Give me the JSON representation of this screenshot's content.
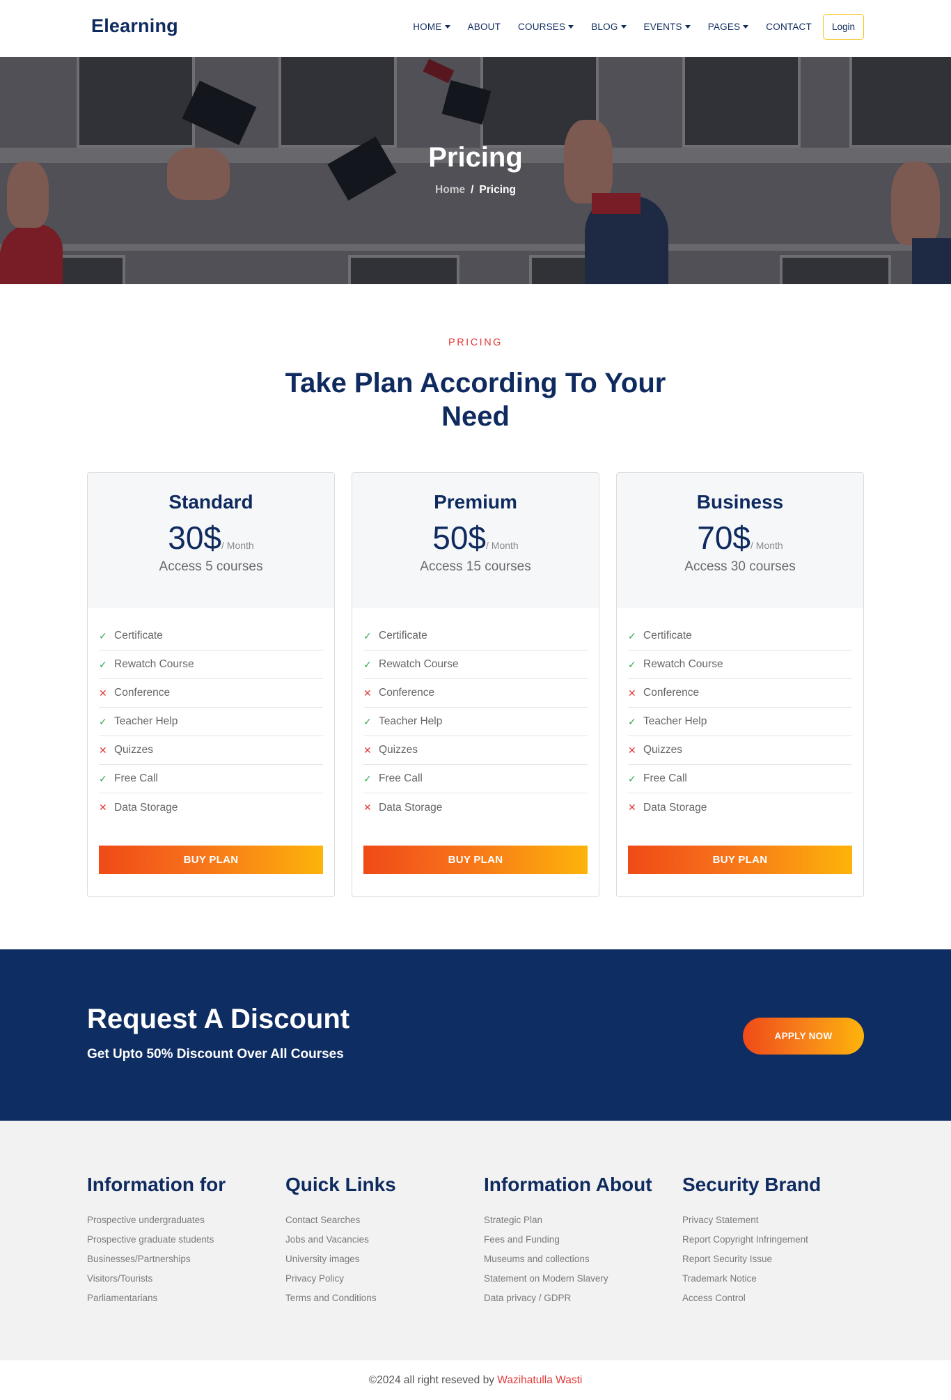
{
  "brand": "Elearning",
  "nav": {
    "items": [
      {
        "label": "HOME",
        "dropdown": true
      },
      {
        "label": "ABOUT",
        "dropdown": false
      },
      {
        "label": "COURSES",
        "dropdown": true
      },
      {
        "label": "BLOG",
        "dropdown": true
      },
      {
        "label": "EVENTS",
        "dropdown": true
      },
      {
        "label": "PAGES",
        "dropdown": true
      },
      {
        "label": "CONTACT",
        "dropdown": false
      }
    ],
    "login": "Login"
  },
  "hero": {
    "title": "Pricing",
    "breadcrumb": {
      "home": "Home",
      "separator": "/",
      "current": "Pricing"
    }
  },
  "pricing": {
    "tag": "PRICING",
    "title": "Take Plan According To Your Need",
    "plans": [
      {
        "name": "Standard",
        "price": "30$",
        "period": "/ Month",
        "access": "Access 5 courses",
        "features": [
          {
            "label": "Certificate",
            "included": true
          },
          {
            "label": "Rewatch Course",
            "included": true
          },
          {
            "label": "Conference",
            "included": false
          },
          {
            "label": "Teacher Help",
            "included": true
          },
          {
            "label": "Quizzes",
            "included": false
          },
          {
            "label": "Free Call",
            "included": true
          },
          {
            "label": "Data Storage",
            "included": false
          }
        ],
        "button": "BUY PLAN"
      },
      {
        "name": "Premium",
        "price": "50$",
        "period": "/ Month",
        "access": "Access 15 courses",
        "features": [
          {
            "label": "Certificate",
            "included": true
          },
          {
            "label": "Rewatch Course",
            "included": true
          },
          {
            "label": "Conference",
            "included": false
          },
          {
            "label": "Teacher Help",
            "included": true
          },
          {
            "label": "Quizzes",
            "included": false
          },
          {
            "label": "Free Call",
            "included": true
          },
          {
            "label": "Data Storage",
            "included": false
          }
        ],
        "button": "BUY PLAN"
      },
      {
        "name": "Business",
        "price": "70$",
        "period": "/ Month",
        "access": "Access 30 courses",
        "features": [
          {
            "label": "Certificate",
            "included": true
          },
          {
            "label": "Rewatch Course",
            "included": true
          },
          {
            "label": "Conference",
            "included": false
          },
          {
            "label": "Teacher Help",
            "included": true
          },
          {
            "label": "Quizzes",
            "included": false
          },
          {
            "label": "Free Call",
            "included": true
          },
          {
            "label": "Data Storage",
            "included": false
          }
        ],
        "button": "BUY PLAN"
      }
    ]
  },
  "discount": {
    "title": "Request A Discount",
    "subtitle": "Get Upto 50% Discount Over All Courses",
    "button": "APPLY NOW"
  },
  "footer": {
    "columns": [
      {
        "title": "Information for",
        "links": [
          "Prospective undergraduates",
          "Prospective graduate students",
          "Businesses/Partnerships",
          "Visitors/Tourists",
          "Parliamentarians"
        ]
      },
      {
        "title": "Quick Links",
        "links": [
          "Contact Searches",
          "Jobs and Vacancies",
          "University images",
          "Privacy Policy",
          "Terms and Conditions"
        ]
      },
      {
        "title": "Information About",
        "links": [
          "Strategic Plan",
          "Fees and Funding",
          "Museums and collections",
          "Statement on Modern Slavery",
          "Data privacy / GDPR"
        ]
      },
      {
        "title": "Security Brand",
        "links": [
          "Privacy Statement",
          "Report Copyright Infringement",
          "Report Security Issue",
          "Trademark Notice",
          "Access Control"
        ]
      }
    ],
    "copyright_prefix": "©2024 all right reseved by",
    "author": "Wazihatulla Wasti"
  },
  "colors": {
    "navy": "#0e2a5e",
    "banner": "#0e2d62",
    "accent_red": "#e23a3a",
    "gradient_start": "#ef4a17",
    "gradient_end": "#fdb40a",
    "check_green": "#2fa84f",
    "login_border": "#f8c31b"
  },
  "icons": {
    "included": "check-icon",
    "excluded": "cross-icon",
    "dropdown": "caret-down-icon"
  }
}
